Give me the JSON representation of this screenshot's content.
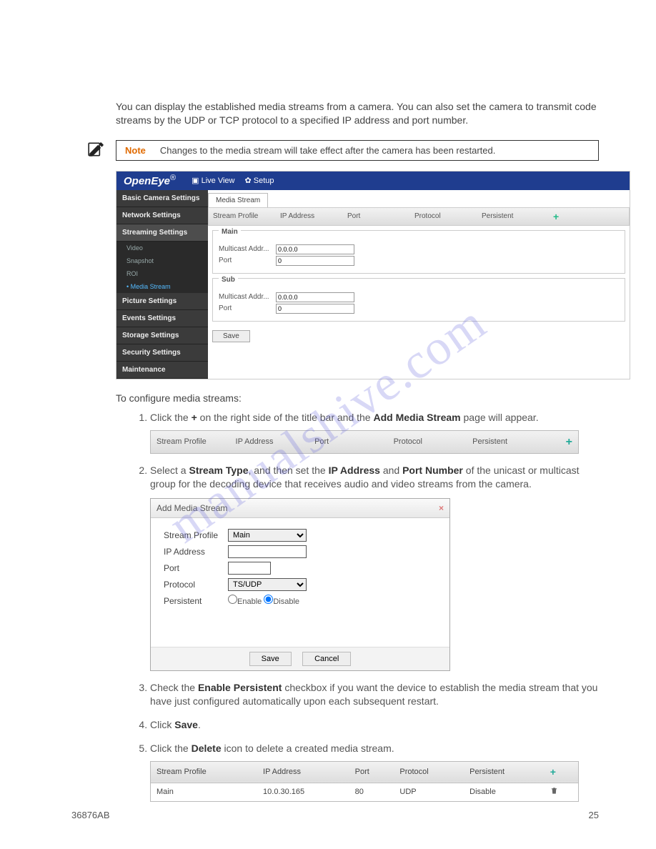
{
  "intro": "You can display the established media streams from a camera. You can also set the camera to transmit code streams by the UDP or TCP protocol to a specified IP address and port number.",
  "note": {
    "label": "Note",
    "text": "Changes to the media stream will take effect after the camera has been restarted."
  },
  "shot1": {
    "brand": "OpenEye",
    "tab_live": "Live View",
    "tab_setup": "Setup",
    "side": {
      "basic": "Basic Camera Settings",
      "network": "Network Settings",
      "streaming": "Streaming Settings",
      "video": "Video",
      "snapshot": "Snapshot",
      "roi": "ROI",
      "media": "Media Stream",
      "picture": "Picture Settings",
      "events": "Events Settings",
      "storage": "Storage Settings",
      "security": "Security Settings",
      "maint": "Maintenance"
    },
    "main_tab": "Media Stream",
    "cols": {
      "profile": "Stream Profile",
      "ip": "IP Address",
      "port": "Port",
      "protocol": "Protocol",
      "persistent": "Persistent"
    },
    "grp_main": {
      "legend": "Main",
      "addr_lbl": "Multicast Addr...",
      "addr_val": "0.0.0.0",
      "port_lbl": "Port",
      "port_val": "0"
    },
    "grp_sub": {
      "legend": "Sub",
      "addr_lbl": "Multicast Addr...",
      "addr_val": "0.0.0.0",
      "port_lbl": "Port",
      "port_val": "0"
    },
    "save": "Save"
  },
  "section_head": "To configure media streams:",
  "steps": {
    "s1a": "Click the ",
    "s1b": "+",
    "s1c": " on the right side of the title bar and the ",
    "s1d": "Add Media Stream",
    "s1e": " page will appear.",
    "s2a": "Select a ",
    "s2b": "Stream Type",
    "s2c": ", and then set the ",
    "s2d": "IP Address",
    "s2e": " and ",
    "s2f": "Port Number",
    "s2g": " of the unicast or multicast group for the decoding device that receives audio and video streams from the camera.",
    "s3a": "Check the ",
    "s3b": "Enable Persistent",
    "s3c": " checkbox if you want the device to establish the media stream that you have just configured automatically upon each subsequent restart.",
    "s4a": "Click ",
    "s4b": "Save",
    "s4c": ".",
    "s5a": "Click the ",
    "s5b": "Delete",
    "s5c": " icon to delete a created media stream."
  },
  "titlebar": {
    "profile": "Stream Profile",
    "ip": "IP Address",
    "port": "Port",
    "protocol": "Protocol",
    "persistent": "Persistent"
  },
  "dialog": {
    "title": "Add Media Stream",
    "profile_lbl": "Stream Profile",
    "profile_val": "Main",
    "ip_lbl": "IP Address",
    "port_lbl": "Port",
    "protocol_lbl": "Protocol",
    "protocol_val": "TS/UDP",
    "persistent_lbl": "Persistent",
    "enable": "Enable",
    "disable": "Disable",
    "save": "Save",
    "cancel": "Cancel"
  },
  "table3": {
    "h": {
      "profile": "Stream Profile",
      "ip": "IP Address",
      "port": "Port",
      "protocol": "Protocol",
      "persistent": "Persistent"
    },
    "row": {
      "profile": "Main",
      "ip": "10.0.30.165",
      "port": "80",
      "protocol": "UDP",
      "persistent": "Disable"
    }
  },
  "footer": {
    "left": "36876AB",
    "right": "25"
  },
  "watermark": "manualshive.com"
}
